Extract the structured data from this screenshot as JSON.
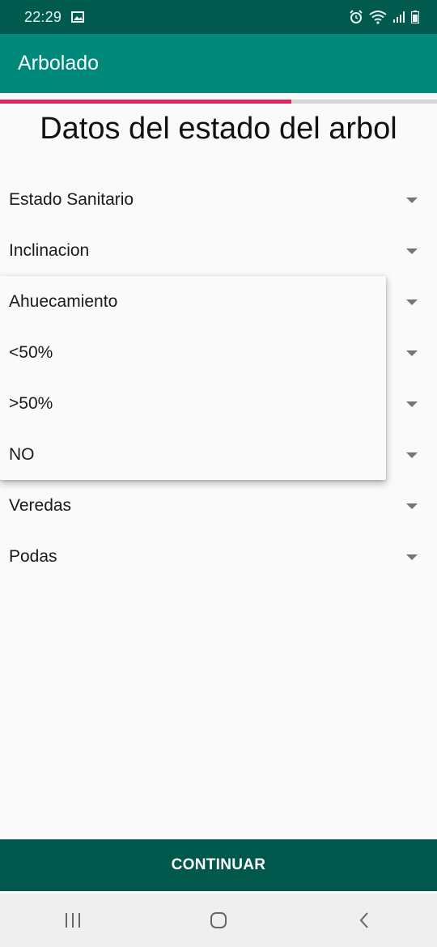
{
  "status_bar": {
    "time": "22:29",
    "icons": [
      "image-icon",
      "alarm-icon",
      "wifi-icon",
      "signal-icon",
      "battery-icon"
    ]
  },
  "app_bar": {
    "title": "Arbolado"
  },
  "progress": {
    "fraction": 0.667,
    "color": "#e0245e"
  },
  "page": {
    "title": "Datos del estado del arbol"
  },
  "spinners": [
    {
      "label": "Estado Sanitario"
    },
    {
      "label": "Inclinacion"
    },
    {
      "label": ""
    },
    {
      "label": ""
    },
    {
      "label": ""
    },
    {
      "label": ""
    },
    {
      "label": "Veredas"
    },
    {
      "label": "Podas"
    }
  ],
  "dropdown": {
    "options": [
      "Ahuecamiento",
      "<50%",
      ">50%",
      "NO"
    ]
  },
  "continue_button": {
    "label": "CONTINUAR"
  },
  "colors": {
    "status_bar": "#005a4e",
    "app_bar": "#00897b",
    "button": "#00574b",
    "accent": "#e0245e"
  },
  "nav_bar": {
    "icons": [
      "recent-apps-icon",
      "home-icon",
      "back-icon"
    ]
  }
}
